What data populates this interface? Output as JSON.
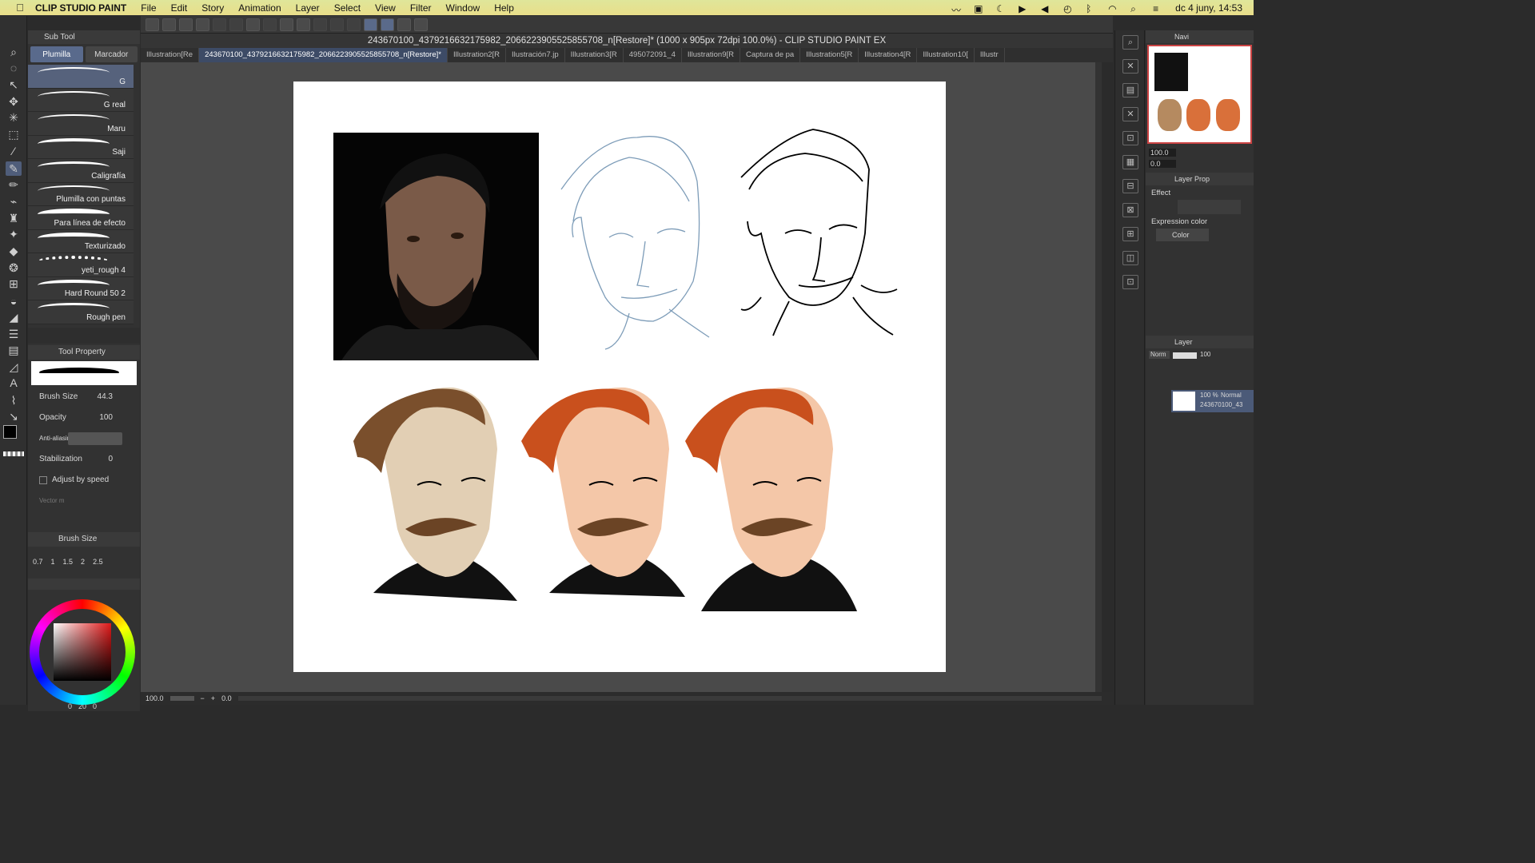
{
  "menubar": {
    "app": "CLIP STUDIO PAINT",
    "items": [
      "File",
      "Edit",
      "Story",
      "Animation",
      "Layer",
      "Select",
      "View",
      "Filter",
      "Window",
      "Help"
    ],
    "datetime": "dc 4 juny, 14:53"
  },
  "document": {
    "title": "243670100_4379216632175982_2066223905525855708_n[Restore]* (1000 x 905px 72dpi 100.0%)  - CLIP STUDIO PAINT EX",
    "tabs": [
      "Illustration[Re",
      "243670100_4379216632175982_2066223905525855708_n[Restore]*",
      "Illustration2[R",
      "Ilustración7.jp",
      "Illustration3[R",
      "495072091_4",
      "Illustration9[R",
      "Captura de pa",
      "Illustration5[R",
      "Illustration4[R",
      "Illustration10[",
      "Illustr"
    ]
  },
  "subtool": {
    "header": "Sub Tool",
    "tab_a": "Plumilla",
    "tab_b": "Marcador",
    "brushes": [
      "G",
      "G real",
      "Maru",
      "Saji",
      "Caligrafía",
      "Plumilla con puntas",
      "Para línea de efecto",
      "Texturizado",
      "yeti_rough 4",
      "Hard Round 50 2",
      "Rough pen"
    ]
  },
  "toolproperty": {
    "header": "Tool Property",
    "brush_size_label": "Brush Size",
    "brush_size": "44.3",
    "opacity_label": "Opacity",
    "opacity": "100",
    "antialias_label": "Anti-aliasing",
    "stabilization_label": "Stabilization",
    "stabilization": "0",
    "adjust_label": "Adjust by speed",
    "vector_label": "Vector m"
  },
  "brushsize": {
    "header": "Brush Size",
    "values": [
      "0.7",
      "1",
      "1.5",
      "2",
      "2.5"
    ]
  },
  "colorbar": {
    "a": "0",
    "b": "20",
    "c": "0"
  },
  "status": {
    "zoom": "100.0",
    "rotate": "0.0"
  },
  "navigator": {
    "header": "Navi",
    "zoom": "100.0",
    "angle": "0.0"
  },
  "layerprop": {
    "header": "Layer Prop",
    "effect_label": "Effect",
    "expression_label": "Expression color",
    "expression_value": "Color"
  },
  "layer": {
    "header": "Layer",
    "blend": "Norm",
    "opacity": "100",
    "item_pct": "100 %",
    "item_mode": "Normal",
    "item_name": "243670100_43"
  }
}
